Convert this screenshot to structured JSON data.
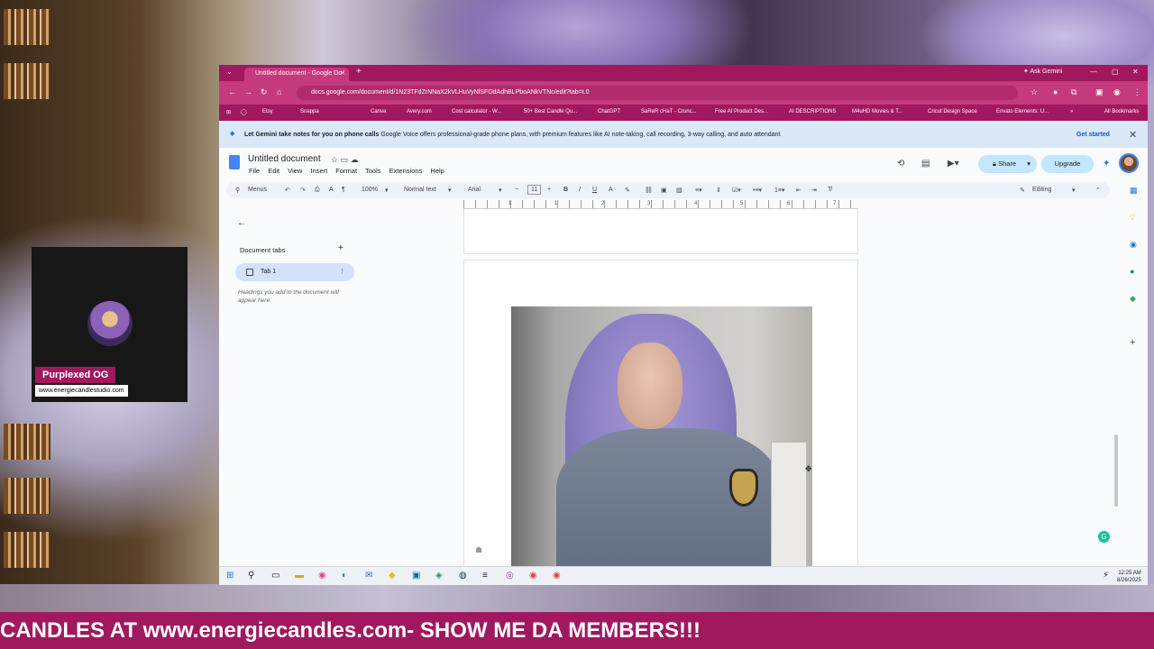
{
  "browser": {
    "tab_title": "Untitled document - Google Do",
    "tab_close": "✕",
    "new_tab": "+",
    "ask_gemini": "Ask Gemini",
    "url": "docs.google.com/document/d/1N23TFdZrNNaX2kVLHuVyNlSFOdAdhBLPboANkVTNc/edit?tab=t.0",
    "bookmarks": [
      "Etsy",
      "Snappa",
      "Canva",
      "Avery.com",
      "Cost calculator - W...",
      "50+ Best Candle Qu...",
      "ChatGPT",
      "SaReR cHaT - Crunc...",
      "Free AI Product Des...",
      "AI DESCRIPTIONS",
      "M4uHD Movies & T...",
      "Cricut Design Space",
      "Envato Elements: U...",
      "All Bookmarks"
    ]
  },
  "gemini_banner": {
    "bold": "Let Gemini take notes for you on phone calls",
    "text": "Google Voice offers professional-grade phone plans, with premium features like AI note-taking, call recording, 3-way calling, and auto attendant",
    "cta": "Get started"
  },
  "doc": {
    "title": "Untitled document",
    "menus": [
      "File",
      "Edit",
      "View",
      "Insert",
      "Format",
      "Tools",
      "Extensions",
      "Help"
    ],
    "share": "Share",
    "upgrade": "Upgrade"
  },
  "toolbar": {
    "menus_search": "Menus",
    "zoom": "100%",
    "style": "Normal text",
    "font": "Arial",
    "size": "11",
    "mode": "Editing"
  },
  "sidebar": {
    "heading": "Document tabs",
    "tab_name": "Tab 1",
    "hint": "Headings you add to the document will appear here"
  },
  "ruler_numbers": [
    "1",
    "1",
    "2",
    "3",
    "4",
    "5",
    "6",
    "7"
  ],
  "webcam": {
    "name": "Purplexed OG",
    "url": "www.energiecandlestudio.com"
  },
  "taskbar": {
    "time": "12:25 AM",
    "date": "8/26/2025"
  },
  "ticker": "CANDLES AT www.energiecandles.com- SHOW ME DA MEMBERS!!!"
}
